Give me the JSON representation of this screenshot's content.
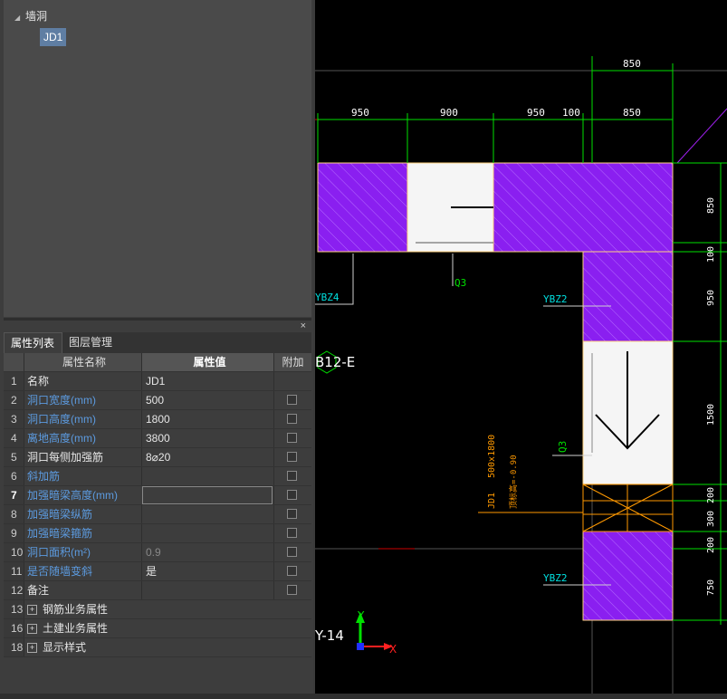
{
  "tree": {
    "root_label": "墙洞",
    "child_label": "JD1"
  },
  "panel": {
    "tabs": [
      "属性列表",
      "图层管理"
    ],
    "close_glyph": "×",
    "columns": {
      "name": "属性名称",
      "value": "属性值",
      "extra": "附加"
    },
    "rows": [
      {
        "num": "1",
        "name": "名称",
        "value": "JD1"
      },
      {
        "num": "2",
        "name": "洞口宽度(mm)",
        "value": "500"
      },
      {
        "num": "3",
        "name": "洞口高度(mm)",
        "value": "1800"
      },
      {
        "num": "4",
        "name": "离地高度(mm)",
        "value": "3800"
      },
      {
        "num": "5",
        "name": "洞口每侧加强筋",
        "value": "8⌀20"
      },
      {
        "num": "6",
        "name": "斜加筋",
        "value": ""
      },
      {
        "num": "7",
        "name": "加强暗梁高度(mm)",
        "value": ""
      },
      {
        "num": "8",
        "name": "加强暗梁纵筋",
        "value": ""
      },
      {
        "num": "9",
        "name": "加强暗梁箍筋",
        "value": ""
      },
      {
        "num": "10",
        "name": "洞口面积(m²)",
        "value": "0.9"
      },
      {
        "num": "11",
        "name": "是否随墙变斜",
        "value": "是"
      },
      {
        "num": "12",
        "name": "备注",
        "value": ""
      }
    ],
    "groups": [
      {
        "num": "13",
        "name": "钢筋业务属性"
      },
      {
        "num": "16",
        "name": "土建业务属性"
      },
      {
        "num": "18",
        "name": "显示样式"
      }
    ]
  },
  "cad": {
    "dims_top": [
      "850"
    ],
    "dims_row": [
      "950",
      "900",
      "950",
      "100",
      "850"
    ],
    "dims_right": [
      "850",
      "100",
      "950",
      "1500",
      "200",
      "300",
      "200",
      "750"
    ],
    "labels": {
      "ybz4": "YBZ4",
      "q3_top": "Q3",
      "ybz2_top": "YBZ2",
      "axis_b": "B12-E",
      "q3_side": "Q3",
      "jd1": "JD1",
      "jd1_size": "500x1800",
      "jd1_elev": "顶标高=-0.90",
      "ybz2_bot": "YBZ2",
      "axis_y": "Y-14",
      "ucs_y": "Y",
      "ucs_x": "X"
    },
    "colors": {
      "hatch": "#8a1ff0",
      "dim": "#00e000",
      "label": "#00e0e0",
      "opening": "#ff9900"
    }
  }
}
